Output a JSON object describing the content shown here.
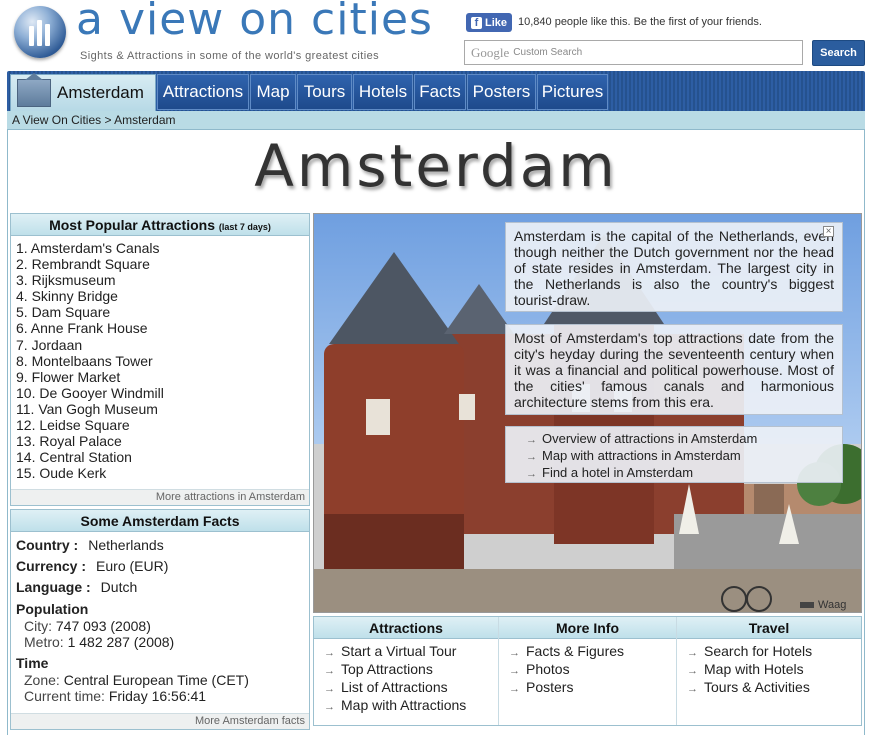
{
  "header": {
    "site_title": "a view on cities",
    "tagline": "Sights & Attractions in some of the world's greatest cities",
    "fb_like_label": "Like",
    "fb_text": "10,840 people like this. Be the first of your friends.",
    "search_placeholder": "Custom Search",
    "search_google_label": "Google",
    "search_button": "Search"
  },
  "nav": {
    "home": "Amsterdam",
    "tabs": [
      "Attractions",
      "Map",
      "Tours",
      "Hotels",
      "Facts",
      "Posters",
      "Pictures"
    ]
  },
  "breadcrumb": "A View On Cities > Amsterdam",
  "page_title": "Amsterdam",
  "popular": {
    "title": "Most Popular Attractions",
    "subtitle": "(last 7 days)",
    "items": [
      "1. Amsterdam's Canals",
      "2. Rembrandt Square",
      "3. Rijksmuseum",
      "4. Skinny Bridge",
      "5. Dam Square",
      "6. Anne Frank House",
      "7. Jordaan",
      "8. Montelbaans Tower",
      "9. Flower Market",
      "10. De Gooyer Windmill",
      "11. Van Gogh Museum",
      "12. Leidse Square",
      "13. Royal Palace",
      "14. Central Station",
      "15. Oude Kerk"
    ],
    "more": "More attractions in Amsterdam"
  },
  "facts": {
    "title": "Some Amsterdam Facts",
    "country_label": "Country :",
    "country": "Netherlands",
    "currency_label": "Currency :",
    "currency": "Euro (EUR)",
    "language_label": "Language :",
    "language": "Dutch",
    "population_label": "Population",
    "city_label": "City:",
    "city": "747 093 (2008)",
    "metro_label": "Metro:",
    "metro": "1 482 287 (2008)",
    "time_label": "Time",
    "zone_label": "Zone:",
    "zone": "Central European Time (CET)",
    "current_label": "Current time:",
    "current": "Friday 16:56:41",
    "more": "More Amsterdam facts"
  },
  "photo": {
    "intro": "Amsterdam is the capital of the Netherlands, even though neither the Dutch government nor the head of state resides in Amsterdam. The largest city in the Netherlands is also the country's biggest tourist-draw.",
    "history": "Most of Amsterdam's top attractions date from the city's heyday during the seventeenth century when it was a financial and political powerhouse. Most of the cities' famous canals and harmonious architecture stems from this era.",
    "links": [
      "Overview of attractions in Amsterdam",
      "Map with attractions in Amsterdam",
      "Find a hotel in Amsterdam"
    ],
    "caption": "Waag"
  },
  "bottom": {
    "attractions": {
      "title": "Attractions",
      "items": [
        "Start a Virtual Tour",
        "Top Attractions",
        "List of Attractions",
        "Map with Attractions"
      ]
    },
    "more_info": {
      "title": "More Info",
      "items": [
        "Facts & Figures",
        "Photos",
        "Posters"
      ]
    },
    "travel": {
      "title": "Travel",
      "items": [
        "Search for Hotels",
        "Map with Hotels",
        "Tours & Activities"
      ]
    }
  }
}
